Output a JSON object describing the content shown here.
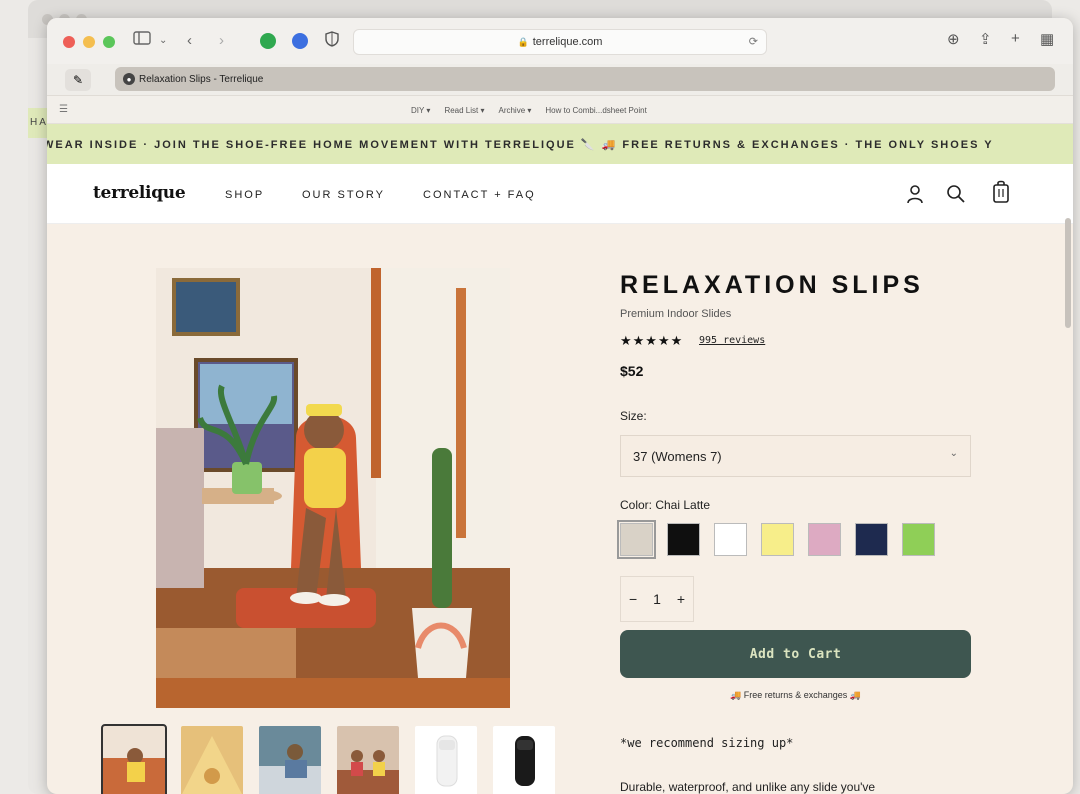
{
  "browser": {
    "url": "terrelique.com",
    "tab_title": "Relaxation Slips - Terrelique",
    "bookmarks": [
      "DIY ▾",
      "Read List ▾",
      "Archive ▾",
      "How to Combi...dsheet Point"
    ]
  },
  "announcement": {
    "text": "WEAR INSIDE  ·  JOIN THE SHOE-FREE HOME MOVEMENT WITH TERRELIQUE 🔪   🚚 FREE RETURNS & EXCHANGES  ·  THE ONLY SHOES Y"
  },
  "nav": {
    "logo": "terrelique",
    "links": [
      "SHOP",
      "OUR STORY",
      "CONTACT + FAQ"
    ]
  },
  "product": {
    "title": "RELAXATION SLIPS",
    "subtitle": "Premium Indoor Slides",
    "stars": "★★★★★",
    "reviews": "995 reviews",
    "price": "$52",
    "size_label": "Size:",
    "size_value": "37 (Womens 7)",
    "color_label": "Color: Chai Latte",
    "colors": [
      "#d9d2c7",
      "#0f0f0f",
      "#ffffff",
      "#f7ee8a",
      "#ddaac2",
      "#1e2a4f",
      "#8fcf57"
    ],
    "quantity": "1",
    "add_to_cart": "Add to Cart",
    "free_returns": "🚚 Free returns & exchanges 🚚",
    "note": "*we recommend sizing up*",
    "description": "Durable, waterproof, and unlike any slide you've"
  },
  "colors": {
    "announcement_bg": "#dfeab8",
    "page_bg": "#f7efe6",
    "cta_bg": "#3e5650",
    "cta_text": "#dbe4c0"
  }
}
